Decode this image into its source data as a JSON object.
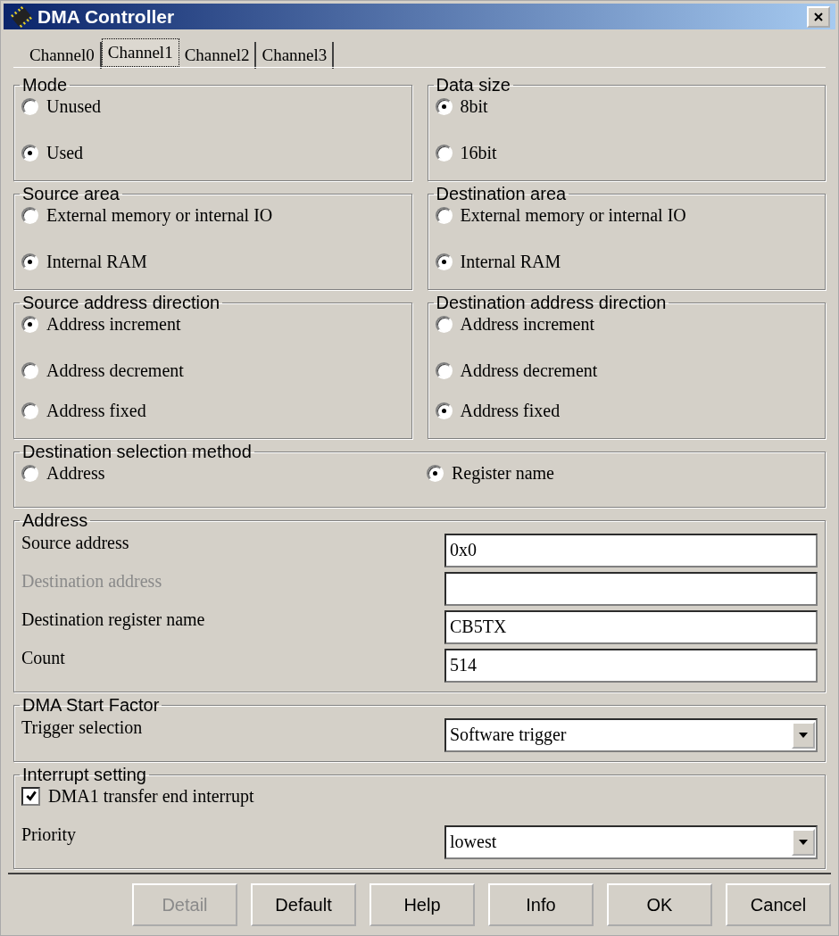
{
  "window": {
    "title": "DMA Controller"
  },
  "tabs": [
    {
      "label": "Channel0",
      "selected": false
    },
    {
      "label": "Channel1",
      "selected": true
    },
    {
      "label": "Channel2",
      "selected": false
    },
    {
      "label": "Channel3",
      "selected": false
    }
  ],
  "group_rows": [
    [
      {
        "title": "Mode",
        "options": [
          {
            "label": "Unused",
            "selected": false
          },
          {
            "label": "Used",
            "selected": true
          }
        ]
      },
      {
        "title": "Data size",
        "options": [
          {
            "label": "8bit",
            "selected": true
          },
          {
            "label": "16bit",
            "selected": false
          }
        ]
      }
    ],
    [
      {
        "title": "Source area",
        "options": [
          {
            "label": "External memory or internal IO",
            "selected": false
          },
          {
            "label": "Internal RAM",
            "selected": true
          }
        ]
      },
      {
        "title": "Destination area",
        "options": [
          {
            "label": "External memory or internal IO",
            "selected": false
          },
          {
            "label": "Internal RAM",
            "selected": true
          }
        ]
      }
    ],
    [
      {
        "title": "Source address direction",
        "options": [
          {
            "label": "Address increment",
            "selected": true
          },
          {
            "label": "Address decrement",
            "selected": false
          },
          {
            "label": "Address fixed",
            "selected": false
          }
        ]
      },
      {
        "title": "Destination address direction",
        "options": [
          {
            "label": "Address increment",
            "selected": false
          },
          {
            "label": "Address decrement",
            "selected": false
          },
          {
            "label": "Address fixed",
            "selected": true
          }
        ]
      }
    ]
  ],
  "selection_method": {
    "title": "Destination selection method",
    "options": [
      {
        "label": "Address",
        "selected": false
      },
      {
        "label": "Register name",
        "selected": true
      }
    ]
  },
  "address": {
    "title": "Address",
    "fields": [
      {
        "label": "Source address",
        "value": "0x0",
        "disabled": false
      },
      {
        "label": "Destination address",
        "disabled": true
      },
      {
        "label": "Destination register name",
        "value": "CB5TX",
        "disabled": false
      },
      {
        "label": "Count",
        "value": "514",
        "disabled": false
      }
    ]
  },
  "start_factor": {
    "title": "DMA Start Factor",
    "label": "Trigger selection",
    "value": "Software trigger"
  },
  "interrupt": {
    "title": "Interrupt setting",
    "checkbox": {
      "label": "DMA1 transfer end interrupt",
      "checked": true
    },
    "label": "Priority",
    "value": "lowest"
  },
  "buttons": [
    {
      "label": "Detail",
      "disabled": true
    },
    {
      "label": "Default",
      "disabled": false
    },
    {
      "label": "Help",
      "disabled": false
    },
    {
      "label": "Info",
      "disabled": false
    },
    {
      "label": "OK",
      "disabled": false
    },
    {
      "label": "Cancel",
      "disabled": false
    }
  ]
}
